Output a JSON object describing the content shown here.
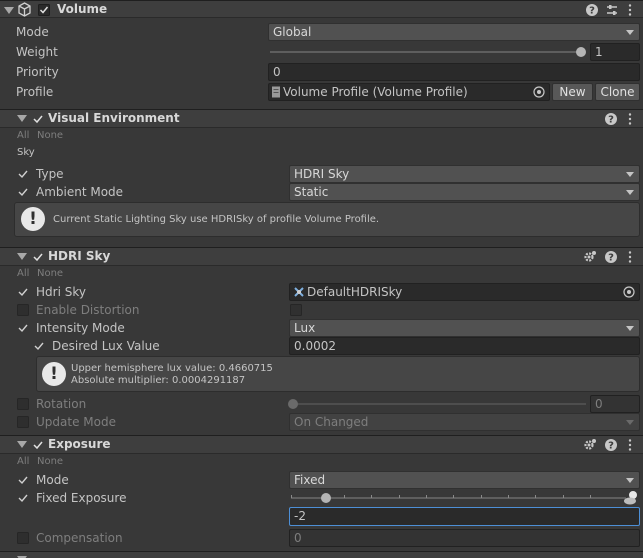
{
  "component": {
    "title": "Volume"
  },
  "rows": {
    "mode_label": "Mode",
    "mode_value": "Global",
    "weight_label": "Weight",
    "weight_value": "1",
    "priority_label": "Priority",
    "priority_value": "0",
    "profile_label": "Profile",
    "profile_value": "Volume Profile (Volume Profile)",
    "new_button": "New",
    "clone_button": "Clone"
  },
  "visual_env": {
    "title": "Visual Environment",
    "all": "All",
    "none": "None",
    "sky_heading": "Sky",
    "type_label": "Type",
    "type_value": "HDRI Sky",
    "ambient_label": "Ambient Mode",
    "ambient_value": "Static",
    "help": "Current Static Lighting Sky use HDRISky of profile Volume Profile."
  },
  "hdri": {
    "title": "HDRI Sky",
    "all": "All",
    "none": "None",
    "hdri_label": "Hdri Sky",
    "hdri_value": "DefaultHDRISky",
    "distortion_label": "Enable Distortion",
    "intensity_label": "Intensity Mode",
    "intensity_value": "Lux",
    "lux_label": "Desired Lux Value",
    "lux_value": "0.0002",
    "help_line1": "Upper hemisphere lux value: 0.4660715",
    "help_line2": "Absolute multiplier: 0.0004291187",
    "rotation_label": "Rotation",
    "rotation_value": "0",
    "update_label": "Update Mode",
    "update_value": "On Changed"
  },
  "exposure": {
    "title": "Exposure",
    "all": "All",
    "none": "None",
    "mode_label": "Mode",
    "mode_value": "Fixed",
    "fixed_label": "Fixed Exposure",
    "fixed_value": "-2",
    "comp_label": "Compensation",
    "comp_value": "0"
  },
  "colors": {
    "accent": "#4d8fd6",
    "background": "#383838"
  }
}
